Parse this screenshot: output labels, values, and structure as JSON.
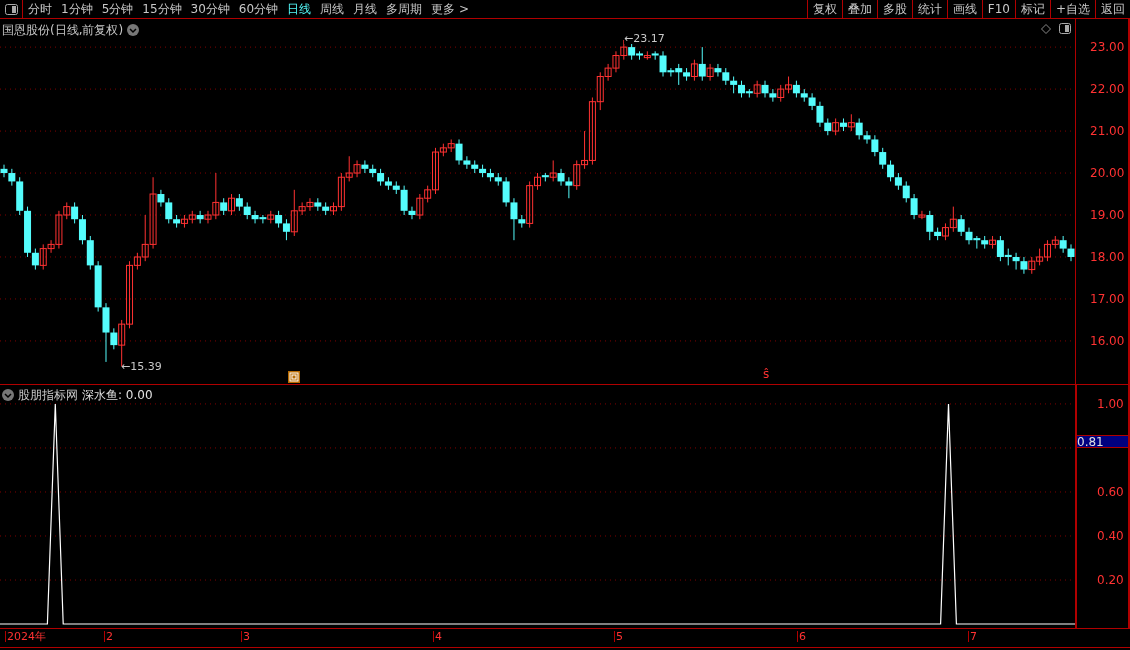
{
  "toolbar": {
    "periods": [
      {
        "label": "分时",
        "selected": false
      },
      {
        "label": "1分钟",
        "selected": false
      },
      {
        "label": "5分钟",
        "selected": false
      },
      {
        "label": "15分钟",
        "selected": false
      },
      {
        "label": "30分钟",
        "selected": false
      },
      {
        "label": "60分钟",
        "selected": false
      },
      {
        "label": "日线",
        "selected": true
      },
      {
        "label": "周线",
        "selected": false
      },
      {
        "label": "月线",
        "selected": false
      },
      {
        "label": "多周期",
        "selected": false
      },
      {
        "label": "更多 >",
        "selected": false
      }
    ],
    "buttons": [
      "复权",
      "叠加",
      "多股",
      "统计",
      "画线",
      "F10",
      "标记",
      "+自选",
      "返回"
    ]
  },
  "main_chart": {
    "title": "国恩股份(日线,前复权)",
    "high_marker": "←23.17",
    "low_marker": "←15.39",
    "signal_mark": "ŝ",
    "chart_data": {
      "type": "candlestick",
      "ylim": [
        14.95,
        23.67
      ],
      "grid": true,
      "yticks": [
        {
          "value": 23,
          "label": "23.00"
        },
        {
          "value": 22,
          "label": "22.00"
        },
        {
          "value": 21,
          "label": "21.00"
        },
        {
          "value": 20,
          "label": "20.00"
        },
        {
          "value": 19,
          "label": "19.00"
        },
        {
          "value": 18,
          "label": "18.00"
        },
        {
          "value": 17,
          "label": "17.00"
        },
        {
          "value": 16,
          "label": "16.00"
        }
      ],
      "ohlc": [
        [
          20.1,
          20.2,
          19.9,
          20.0
        ],
        [
          20.0,
          20.1,
          19.7,
          19.8
        ],
        [
          19.8,
          19.9,
          19.0,
          19.1
        ],
        [
          19.1,
          19.2,
          18.0,
          18.1
        ],
        [
          18.1,
          18.2,
          17.7,
          17.8
        ],
        [
          17.8,
          18.3,
          17.7,
          18.2
        ],
        [
          18.2,
          18.4,
          18.1,
          18.3
        ],
        [
          18.3,
          19.1,
          18.2,
          19.0
        ],
        [
          19.0,
          19.3,
          18.9,
          19.2
        ],
        [
          19.2,
          19.3,
          18.8,
          18.9
        ],
        [
          18.9,
          19.0,
          18.3,
          18.4
        ],
        [
          18.4,
          18.5,
          17.7,
          17.8
        ],
        [
          17.8,
          17.9,
          16.7,
          16.8
        ],
        [
          16.8,
          16.9,
          15.5,
          16.2
        ],
        [
          16.2,
          16.3,
          15.8,
          15.9
        ],
        [
          15.9,
          16.5,
          15.39,
          16.4
        ],
        [
          16.4,
          17.9,
          16.3,
          17.8
        ],
        [
          17.8,
          18.1,
          17.7,
          18.0
        ],
        [
          18.0,
          19.0,
          17.9,
          18.3
        ],
        [
          18.3,
          19.9,
          18.2,
          19.5
        ],
        [
          19.5,
          19.6,
          19.2,
          19.3
        ],
        [
          19.3,
          19.4,
          18.8,
          18.9
        ],
        [
          18.9,
          19.0,
          18.7,
          18.8
        ],
        [
          18.8,
          19.0,
          18.7,
          18.9
        ],
        [
          18.9,
          19.1,
          18.8,
          19.0
        ],
        [
          19.0,
          19.1,
          18.8,
          18.9
        ],
        [
          18.9,
          19.1,
          18.8,
          19.0
        ],
        [
          19.0,
          20.0,
          18.9,
          19.3
        ],
        [
          19.3,
          19.4,
          19.0,
          19.1
        ],
        [
          19.1,
          19.5,
          19.0,
          19.4
        ],
        [
          19.4,
          19.5,
          19.1,
          19.2
        ],
        [
          19.2,
          19.3,
          18.9,
          19.0
        ],
        [
          19.0,
          19.1,
          18.8,
          18.9
        ],
        [
          18.95,
          19.0,
          18.8,
          18.9
        ],
        [
          18.9,
          19.1,
          18.8,
          19.0
        ],
        [
          19.0,
          19.1,
          18.7,
          18.8
        ],
        [
          18.8,
          18.9,
          18.4,
          18.6
        ],
        [
          18.6,
          19.6,
          18.5,
          19.1
        ],
        [
          19.1,
          19.3,
          19.0,
          19.2
        ],
        [
          19.2,
          19.4,
          19.1,
          19.3
        ],
        [
          19.3,
          19.4,
          19.1,
          19.2
        ],
        [
          19.2,
          19.3,
          19.0,
          19.1
        ],
        [
          19.1,
          19.3,
          19.0,
          19.2
        ],
        [
          19.2,
          20.0,
          19.1,
          19.9
        ],
        [
          19.9,
          20.4,
          19.8,
          20.0
        ],
        [
          20.0,
          20.3,
          19.9,
          20.2
        ],
        [
          20.2,
          20.3,
          20.0,
          20.1
        ],
        [
          20.1,
          20.2,
          19.9,
          20.0
        ],
        [
          20.0,
          20.1,
          19.7,
          19.8
        ],
        [
          19.8,
          19.9,
          19.6,
          19.7
        ],
        [
          19.7,
          19.8,
          19.5,
          19.6
        ],
        [
          19.6,
          19.7,
          19.0,
          19.1
        ],
        [
          19.1,
          19.2,
          18.9,
          19.0
        ],
        [
          19.0,
          19.5,
          18.9,
          19.4
        ],
        [
          19.4,
          19.7,
          19.3,
          19.6
        ],
        [
          19.6,
          20.6,
          19.5,
          20.5
        ],
        [
          20.5,
          20.7,
          20.4,
          20.6
        ],
        [
          20.6,
          20.8,
          20.5,
          20.7
        ],
        [
          20.7,
          20.8,
          20.2,
          20.3
        ],
        [
          20.3,
          20.4,
          20.1,
          20.2
        ],
        [
          20.2,
          20.3,
          20.0,
          20.1
        ],
        [
          20.1,
          20.2,
          19.9,
          20.0
        ],
        [
          20.0,
          20.1,
          19.8,
          19.9
        ],
        [
          19.9,
          20.0,
          19.7,
          19.8
        ],
        [
          19.8,
          19.9,
          19.2,
          19.3
        ],
        [
          19.3,
          19.4,
          18.4,
          18.9
        ],
        [
          18.9,
          19.0,
          18.7,
          18.8
        ],
        [
          18.8,
          19.8,
          18.7,
          19.7
        ],
        [
          19.7,
          20.0,
          19.6,
          19.9
        ],
        [
          19.95,
          20.0,
          19.8,
          19.9
        ],
        [
          19.9,
          20.3,
          19.8,
          20.0
        ],
        [
          20.0,
          20.1,
          19.7,
          19.8
        ],
        [
          19.8,
          19.9,
          19.4,
          19.7
        ],
        [
          19.7,
          20.3,
          19.6,
          20.2
        ],
        [
          20.2,
          21.0,
          20.1,
          20.3
        ],
        [
          20.3,
          21.8,
          20.2,
          21.7
        ],
        [
          21.7,
          22.4,
          21.5,
          22.3
        ],
        [
          22.3,
          22.6,
          22.2,
          22.5
        ],
        [
          22.5,
          22.9,
          22.4,
          22.8
        ],
        [
          22.8,
          23.17,
          22.7,
          23.0
        ],
        [
          23.0,
          23.1,
          22.7,
          22.8
        ],
        [
          22.85,
          22.9,
          22.7,
          22.8
        ],
        [
          22.75,
          22.9,
          22.7,
          22.8
        ],
        [
          22.85,
          22.9,
          22.7,
          22.8
        ],
        [
          22.8,
          22.9,
          22.3,
          22.4
        ],
        [
          22.45,
          22.5,
          22.3,
          22.4
        ],
        [
          22.5,
          22.6,
          22.1,
          22.4
        ],
        [
          22.4,
          22.5,
          22.2,
          22.3
        ],
        [
          22.3,
          22.7,
          22.2,
          22.6
        ],
        [
          22.6,
          23.0,
          22.2,
          22.3
        ],
        [
          22.3,
          22.6,
          22.2,
          22.5
        ],
        [
          22.5,
          22.6,
          22.3,
          22.4
        ],
        [
          22.4,
          22.5,
          22.1,
          22.2
        ],
        [
          22.2,
          22.3,
          21.9,
          22.1
        ],
        [
          22.1,
          22.2,
          21.8,
          21.9
        ],
        [
          21.95,
          22.0,
          21.8,
          21.9
        ],
        [
          21.9,
          22.2,
          21.8,
          22.1
        ],
        [
          22.1,
          22.2,
          21.8,
          21.9
        ],
        [
          21.9,
          22.0,
          21.7,
          21.8
        ],
        [
          21.8,
          22.1,
          21.7,
          22.0
        ],
        [
          22.0,
          22.3,
          21.9,
          22.1
        ],
        [
          22.1,
          22.2,
          21.8,
          21.9
        ],
        [
          21.9,
          22.0,
          21.7,
          21.8
        ],
        [
          21.8,
          21.9,
          21.5,
          21.6
        ],
        [
          21.6,
          21.7,
          21.1,
          21.2
        ],
        [
          21.2,
          21.3,
          20.9,
          21.0
        ],
        [
          21.0,
          21.3,
          20.9,
          21.2
        ],
        [
          21.2,
          21.3,
          21.0,
          21.1
        ],
        [
          21.1,
          21.4,
          21.0,
          21.2
        ],
        [
          21.2,
          21.3,
          20.8,
          20.9
        ],
        [
          20.9,
          21.0,
          20.7,
          20.8
        ],
        [
          20.8,
          20.9,
          20.4,
          20.5
        ],
        [
          20.5,
          20.6,
          20.1,
          20.2
        ],
        [
          20.2,
          20.3,
          19.8,
          19.9
        ],
        [
          19.9,
          20.0,
          19.6,
          19.7
        ],
        [
          19.7,
          19.8,
          19.3,
          19.4
        ],
        [
          19.4,
          19.5,
          18.9,
          19.0
        ],
        [
          18.95,
          19.1,
          18.9,
          19.0
        ],
        [
          19.0,
          19.1,
          18.4,
          18.6
        ],
        [
          18.6,
          18.7,
          18.4,
          18.5
        ],
        [
          18.5,
          18.8,
          18.4,
          18.7
        ],
        [
          18.7,
          19.2,
          18.6,
          18.9
        ],
        [
          18.9,
          19.0,
          18.5,
          18.6
        ],
        [
          18.6,
          18.7,
          18.3,
          18.4
        ],
        [
          18.45,
          18.5,
          18.2,
          18.4
        ],
        [
          18.4,
          18.5,
          18.2,
          18.3
        ],
        [
          18.3,
          18.5,
          18.2,
          18.4
        ],
        [
          18.4,
          18.5,
          17.9,
          18.0
        ],
        [
          18.05,
          18.2,
          17.8,
          18.0
        ],
        [
          18.0,
          18.1,
          17.7,
          17.9
        ],
        [
          17.9,
          18.0,
          17.6,
          17.7
        ],
        [
          17.7,
          18.0,
          17.6,
          17.9
        ],
        [
          17.9,
          18.2,
          17.8,
          18.0
        ],
        [
          18.0,
          18.4,
          17.9,
          18.3
        ],
        [
          18.3,
          18.5,
          18.2,
          18.4
        ],
        [
          18.4,
          18.5,
          18.1,
          18.2
        ],
        [
          18.2,
          18.3,
          17.9,
          18.0
        ]
      ]
    }
  },
  "indicator": {
    "title": "股朋指标网",
    "series_label": "深水鱼: 0.00",
    "cursor_value": "0.81",
    "chart_data": {
      "type": "line",
      "ylim": [
        -0.018,
        1.086
      ],
      "grid": true,
      "yticks": [
        {
          "value": 1,
          "label": "1.00"
        },
        {
          "value": 0.6,
          "label": "0.60"
        },
        {
          "value": 0.4,
          "label": "0.40"
        },
        {
          "value": 0.2,
          "label": "0.20"
        }
      ],
      "series": [
        {
          "color": "#ffffff",
          "values": [
            0,
            0,
            0,
            0,
            0,
            0,
            0,
            1,
            0,
            0,
            0,
            0,
            0,
            0,
            0,
            0,
            0,
            0,
            0,
            0,
            0,
            0,
            0,
            0,
            0,
            0,
            0,
            0,
            0,
            0,
            0,
            0,
            0,
            0,
            0,
            0,
            0,
            0,
            0,
            0,
            0,
            0,
            0,
            0,
            0,
            0,
            0,
            0,
            0,
            0,
            0,
            0,
            0,
            0,
            0,
            0,
            0,
            0,
            0,
            0,
            0,
            0,
            0,
            0,
            0,
            0,
            0,
            0,
            0,
            0,
            0,
            0,
            0,
            0,
            0,
            0,
            0,
            0,
            0,
            0,
            0,
            0,
            0,
            0,
            0,
            0,
            0,
            0,
            0,
            0,
            0,
            0,
            0,
            0,
            0,
            0,
            0,
            0,
            0,
            0,
            0,
            0,
            0,
            0,
            0,
            0,
            0,
            0,
            0,
            0,
            0,
            0,
            0,
            0,
            0,
            0,
            0,
            0,
            0,
            0,
            1,
            0,
            0,
            0,
            0,
            0,
            0,
            0,
            0,
            0,
            0,
            0,
            0,
            0,
            0,
            0,
            0
          ]
        }
      ]
    }
  },
  "date_axis": [
    "2024年",
    "2",
    "3",
    "4",
    "5",
    "6",
    "7"
  ]
}
